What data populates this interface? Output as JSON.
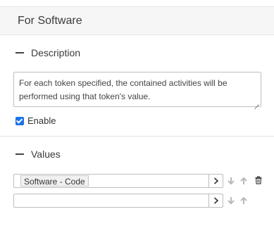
{
  "panel": {
    "title": "For Software"
  },
  "description": {
    "heading": "Description",
    "text": "For each token specified, the contained activities will be performed using that token's value."
  },
  "enable": {
    "label": "Enable",
    "checked": true
  },
  "values": {
    "heading": "Values",
    "rows": [
      {
        "token": "Software - Code"
      },
      {
        "token": ""
      }
    ]
  },
  "icons": {
    "collapse": "minus-icon",
    "go": "chevron-right-icon",
    "down": "arrow-down-icon",
    "up": "arrow-up-icon",
    "delete": "trash-icon",
    "checkbox": "checkbox-checked"
  },
  "colors": {
    "header_bg": "#f6f6f6",
    "checkbox": "#1a73e8",
    "icon_muted": "#b8b8b8",
    "icon_dark": "#444444"
  }
}
